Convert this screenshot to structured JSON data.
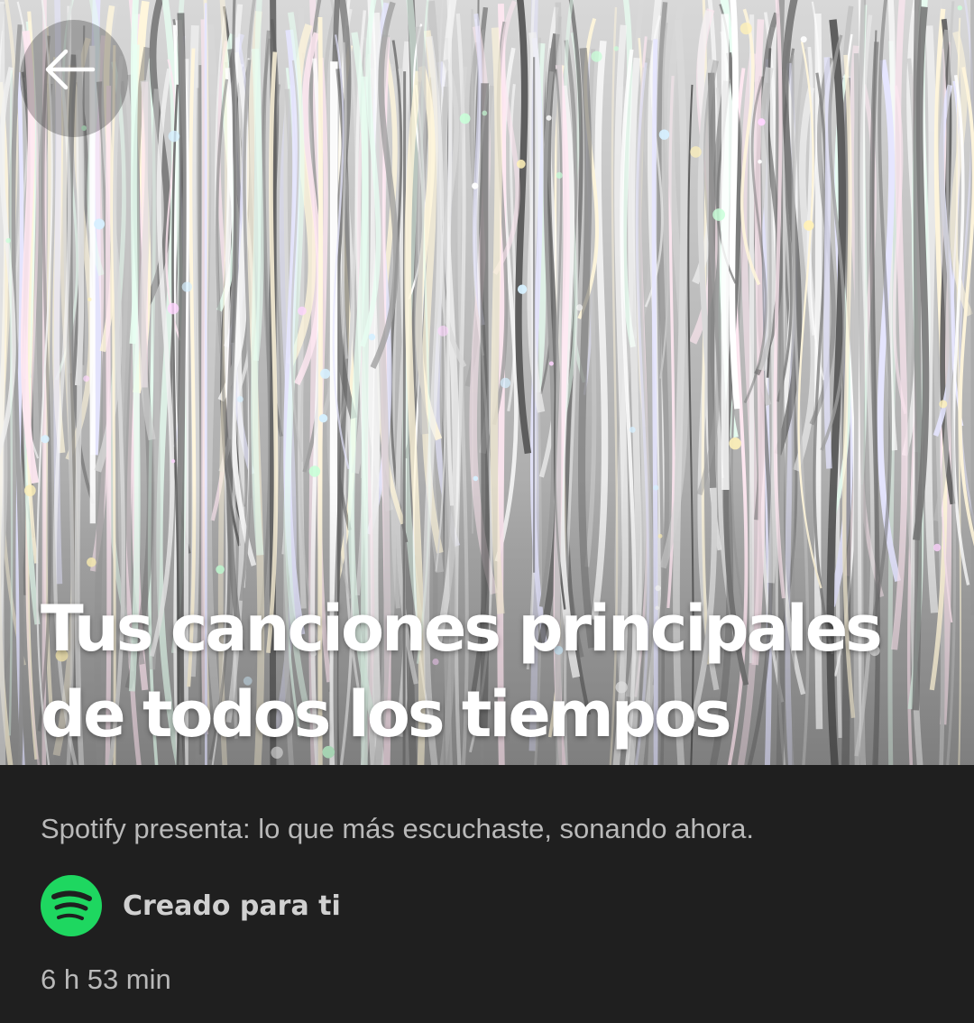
{
  "header": {
    "back_icon": "arrow-left-icon",
    "cover_image": "silver holographic tinsel curtain"
  },
  "playlist": {
    "title_line1": "Tus canciones principales",
    "title_line2": "de todos los tiempos",
    "description": "Spotify presenta: lo que más escuchaste, sonando ahora.",
    "creator_label": "Creado para ti",
    "creator_icon": "spotify-logo-icon",
    "duration": "6 h 53 min"
  },
  "colors": {
    "background": "#1f1f1f",
    "spotify_green": "#1ed760",
    "secondary_text": "#b9b9b9"
  }
}
